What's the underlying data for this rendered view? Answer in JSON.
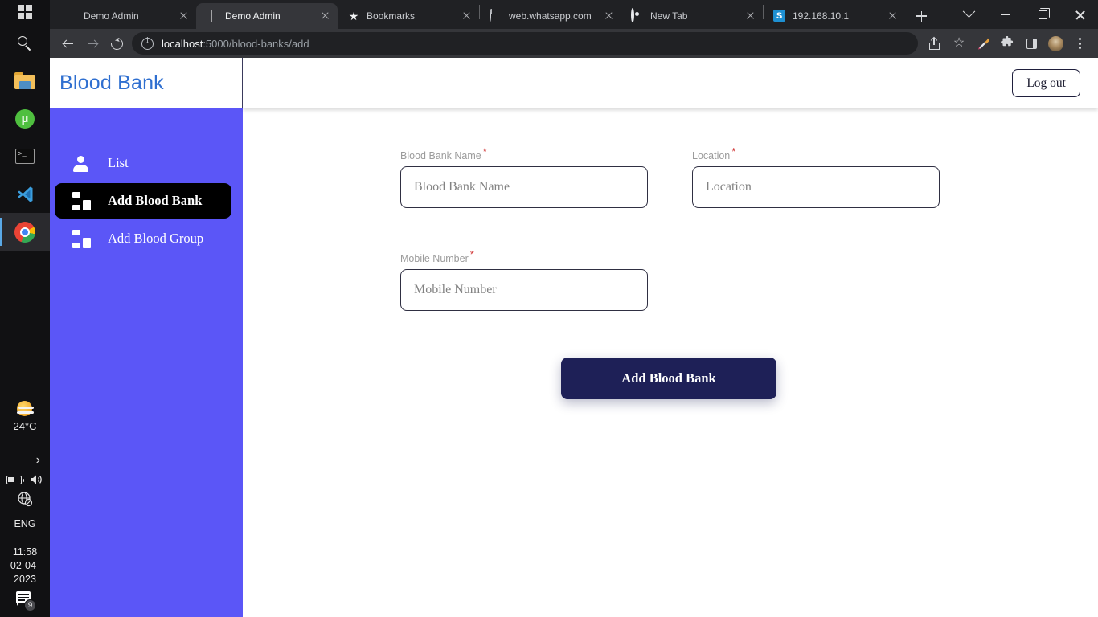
{
  "taskbar": {
    "start_label": "Start",
    "apps": [
      {
        "name": "search-icon",
        "label": "Search"
      },
      {
        "name": "file-explorer-icon",
        "label": "File Explorer"
      },
      {
        "name": "utorrent-icon",
        "label": "uTorrent",
        "glyph": "µ"
      },
      {
        "name": "terminal-icon",
        "label": "Terminal"
      },
      {
        "name": "vscode-icon",
        "label": "Visual Studio Code"
      },
      {
        "name": "chrome-icon",
        "label": "Google Chrome",
        "active": true
      }
    ],
    "tray": {
      "weather_temp": "24°C",
      "weather_icon": "sun-cloud-icon",
      "overflow_chevron": "›",
      "battery_icon": "battery-icon",
      "volume_icon": "speaker-icon",
      "network_icon": "globe-disconnected-icon",
      "language": "ENG",
      "time": "11:58",
      "date": "02-04-2023",
      "notification_count": "9"
    }
  },
  "browser": {
    "tabs": [
      {
        "title": "Demo Admin",
        "favicon": "globe-gray-icon",
        "active": false
      },
      {
        "title": "Demo Admin",
        "favicon": "globe-color-icon",
        "active": true
      },
      {
        "title": "Bookmarks",
        "favicon": "star-icon",
        "active": false
      },
      {
        "title": "web.whatsapp.com",
        "favicon": "info-circle-icon",
        "active": false
      },
      {
        "title": "New Tab",
        "favicon": "chrome-circle-icon",
        "active": false
      },
      {
        "title": "192.168.10.1",
        "favicon": "blue-s-icon",
        "favicon_text": "S",
        "active": false
      }
    ],
    "new_tab_label": "+",
    "window_controls": {
      "tab_search": "tab-search-chevron",
      "minimize": "minimize",
      "maximize": "maximize",
      "close": "close"
    },
    "toolbar": {
      "back": "back-arrow",
      "forward": "forward-arrow",
      "reload": "reload",
      "site_info": "info-circle-icon",
      "url_host": "localhost",
      "url_rest": ":5000/blood-banks/add",
      "actions": [
        {
          "name": "share-icon"
        },
        {
          "name": "bookmark-star-icon"
        },
        {
          "name": "eyedropper-icon"
        },
        {
          "name": "extensions-puzzle-icon"
        },
        {
          "name": "side-panel-icon"
        },
        {
          "name": "profile-avatar"
        },
        {
          "name": "chrome-menu-icon"
        }
      ]
    }
  },
  "app": {
    "brand": "Blood Bank",
    "brand_color": "#2f6fd0",
    "sidebar_color": "#5b56f7",
    "accent_button_color": "#1e2057",
    "logout_label": "Log out",
    "sidebar": {
      "items": [
        {
          "label": "List",
          "icon": "person-icon",
          "active": false
        },
        {
          "label": "Add Blood Bank",
          "icon": "dashboard-grid-icon",
          "active": true
        },
        {
          "label": "Add Blood Group",
          "icon": "dashboard-grid-icon",
          "active": false
        }
      ]
    },
    "form": {
      "fields": [
        {
          "label": "Blood Bank Name",
          "placeholder": "Blood Bank Name",
          "value": "",
          "required": "*"
        },
        {
          "label": "Location",
          "placeholder": "Location",
          "value": "",
          "required": "*"
        },
        {
          "label": "Mobile Number",
          "placeholder": "Mobile Number",
          "value": "",
          "required": "*"
        }
      ],
      "submit_label": "Add Blood Bank"
    }
  }
}
